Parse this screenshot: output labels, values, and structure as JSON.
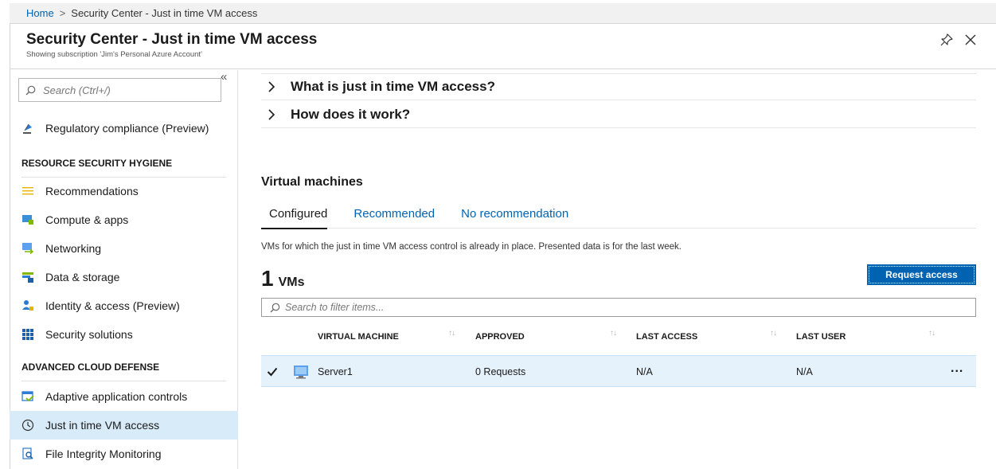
{
  "breadcrumb": {
    "home": "Home",
    "separator": ">",
    "current": "Security Center - Just in time VM access"
  },
  "header": {
    "title": "Security Center - Just in time VM access",
    "subtitle": "Showing subscription 'Jim's Personal Azure Account'"
  },
  "sidebar": {
    "search_placeholder": "Search (Ctrl+/)",
    "collapse_glyph": "«",
    "items_top": [
      {
        "label": "Regulatory compliance (Preview)",
        "icon": "gavel-icon"
      }
    ],
    "section1": "RESOURCE SECURITY HYGIENE",
    "items_hygiene": [
      {
        "label": "Recommendations",
        "icon": "list-icon"
      },
      {
        "label": "Compute & apps",
        "icon": "compute-icon"
      },
      {
        "label": "Networking",
        "icon": "network-icon"
      },
      {
        "label": "Data & storage",
        "icon": "storage-icon"
      },
      {
        "label": "Identity & access (Preview)",
        "icon": "identity-icon"
      },
      {
        "label": "Security solutions",
        "icon": "grid-icon"
      }
    ],
    "section2": "ADVANCED CLOUD DEFENSE",
    "items_defense": [
      {
        "label": "Adaptive application controls",
        "icon": "app-control-icon"
      },
      {
        "label": "Just in time VM access",
        "icon": "clock-icon",
        "active": true
      },
      {
        "label": "File Integrity Monitoring",
        "icon": "file-monitor-icon"
      }
    ]
  },
  "main": {
    "faq": [
      {
        "label": "What is just in time VM access?"
      },
      {
        "label": "How does it work?"
      }
    ],
    "vm_heading": "Virtual machines",
    "tabs": [
      {
        "label": "Configured",
        "active": true
      },
      {
        "label": "Recommended"
      },
      {
        "label": "No recommendation"
      }
    ],
    "description": "VMs for which the just in time VM access control is already in place. Presented data is for the last week.",
    "count_number": "1",
    "count_label": "VMs",
    "request_button": "Request access",
    "filter_placeholder": "Search to filter items...",
    "columns": [
      "VIRTUAL MACHINE",
      "APPROVED",
      "LAST ACCESS",
      "LAST USER"
    ],
    "rows": [
      {
        "name": "Server1",
        "approved": "0 Requests",
        "last_access": "N/A",
        "last_user": "N/A",
        "checked": true
      }
    ],
    "more_glyph": "..."
  },
  "colors": {
    "accent": "#0063b1",
    "active_nav_bg": "#d8ebf9",
    "selected_row_bg": "#e6f2fb"
  }
}
